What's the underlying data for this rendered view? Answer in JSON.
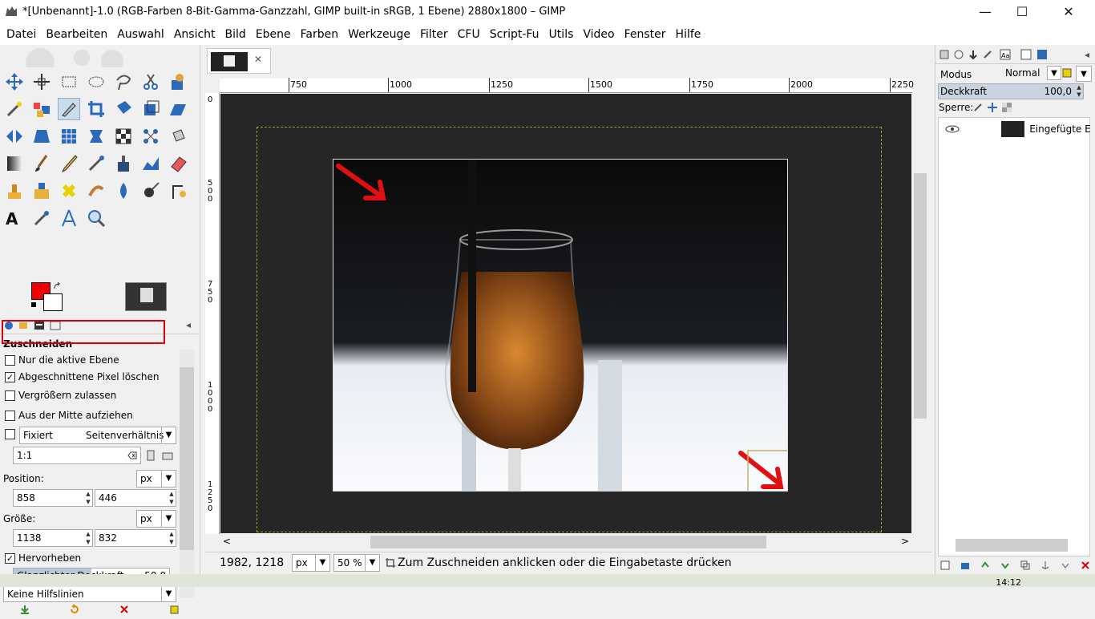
{
  "window": {
    "title": "*[Unbenannt]-1.0 (RGB-Farben 8-Bit-Gamma-Ganzzahl, GIMP built-in sRGB, 1 Ebene) 2880x1800 – GIMP",
    "minimize": "—",
    "maximize": "☐",
    "close": "✕"
  },
  "menu": [
    "Datei",
    "Bearbeiten",
    "Auswahl",
    "Ansicht",
    "Bild",
    "Ebene",
    "Farben",
    "Werkzeuge",
    "Filter",
    "CFU",
    "Script-Fu",
    "Utils",
    "Video",
    "Fenster",
    "Hilfe"
  ],
  "tool_options": {
    "title": "Zuschneiden",
    "only_active_layer": "Nur die aktive Ebene",
    "delete_cropped_pixels": "Abgeschnittene Pixel löschen",
    "allow_growing": "Vergrößern zulassen",
    "expand_from_center": "Aus der Mitte aufziehen",
    "fixed": "Fixiert",
    "aspect_dd": "Seitenverhältnis",
    "ratio_value": "1:1",
    "position_label": "Position:",
    "position_unit": "px",
    "position_x": "858",
    "position_y": "446",
    "size_label": "Größe:",
    "size_unit": "px",
    "size_w": "1138",
    "size_h": "832",
    "highlight": "Hervorheben",
    "highlight_opacity_label": "Glanzlichter-Deckkraft",
    "highlight_opacity_value": "50,0",
    "guides": "Keine Hilfslinien",
    "checked_delete": "✓",
    "checked_highlight": "✓"
  },
  "rulers": {
    "h": [
      "750",
      "1000",
      "1250",
      "1500",
      "1750",
      "2000",
      "2250"
    ],
    "v": [
      "0",
      "500",
      "750",
      "1000",
      "1250"
    ]
  },
  "statusbar": {
    "coords": "1982, 1218",
    "unit": "px",
    "zoom": "50 %",
    "message": "Zum Zuschneiden anklicken oder die Eingabetaste drücken"
  },
  "layers": {
    "mode_label": "Modus",
    "mode_value": "Normal",
    "opacity_label": "Deckkraft",
    "opacity_value": "100,0",
    "lock_label": "Sperre:",
    "layer_name": "Eingefügte Eb"
  },
  "taskbar": {
    "time": "14:12"
  },
  "colors": {
    "foreground": "#f00000",
    "background": "#ffffff",
    "highlight_box": "#e00000"
  }
}
